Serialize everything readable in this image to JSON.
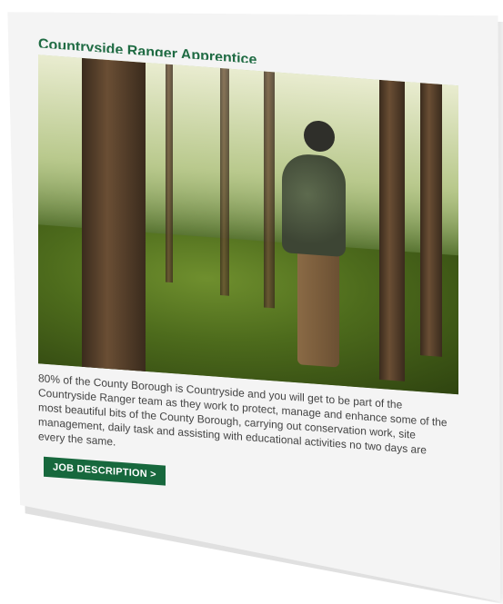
{
  "card": {
    "title": "Countryside Ranger Apprentice",
    "description": "80% of the County Borough is Countryside and you will get to be part of the Countryside Ranger team as they work to protect, manage and enhance some of the most beautiful bits of the County Borough, carrying out conservation work, site management, daily task and assisting with educational activities no two days are every the same.",
    "button_label": "JOB DESCRIPTION >"
  },
  "colors": {
    "accent": "#17683d",
    "title": "#1f6b43",
    "text": "#444444",
    "card_bg": "#f4f4f4"
  }
}
